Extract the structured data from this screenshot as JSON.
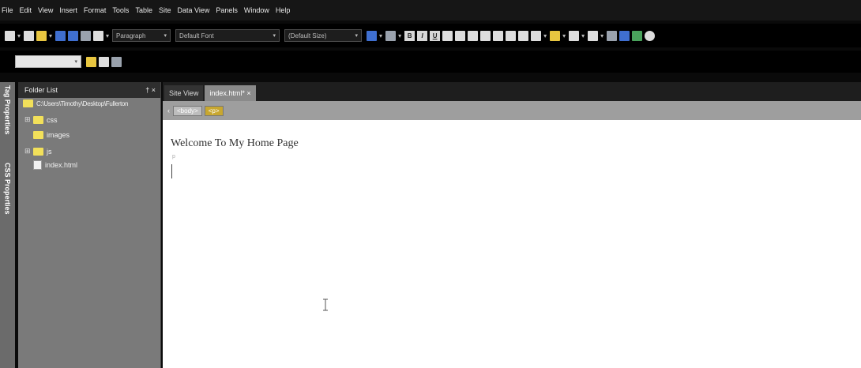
{
  "menu": [
    "File",
    "Edit",
    "View",
    "Insert",
    "Format",
    "Tools",
    "Table",
    "Site",
    "Data View",
    "Panels",
    "Window",
    "Help"
  ],
  "toolbar": {
    "paragraph_style": "Paragraph",
    "font": "Default Font",
    "size": "(Default Size)",
    "format_buttons": [
      "B",
      "I",
      "U"
    ]
  },
  "left_tabs": {
    "tag_properties": "Tag Properties",
    "css_properties": "CSS Properties"
  },
  "folder_list": {
    "title": "Folder List",
    "pin": "†",
    "close": "×",
    "root": "C:\\Users\\Timothy\\Desktop\\Fullerton",
    "items": [
      {
        "name": "css",
        "type": "folder",
        "expander": "⊞"
      },
      {
        "name": "images",
        "type": "folder",
        "expander": ""
      },
      {
        "name": "js",
        "type": "folder",
        "expander": "⊞"
      },
      {
        "name": "index.html",
        "type": "file",
        "expander": ""
      }
    ]
  },
  "doc_tabs": [
    {
      "label": "Site View",
      "active": false
    },
    {
      "label": "index.html* ×",
      "active": true
    }
  ],
  "tag_selector": [
    "<body>",
    "<p>"
  ],
  "tag_selector_arrow": "‹",
  "editor": {
    "content": "Welcome To My Home Page",
    "paragraph_marker": "p"
  }
}
